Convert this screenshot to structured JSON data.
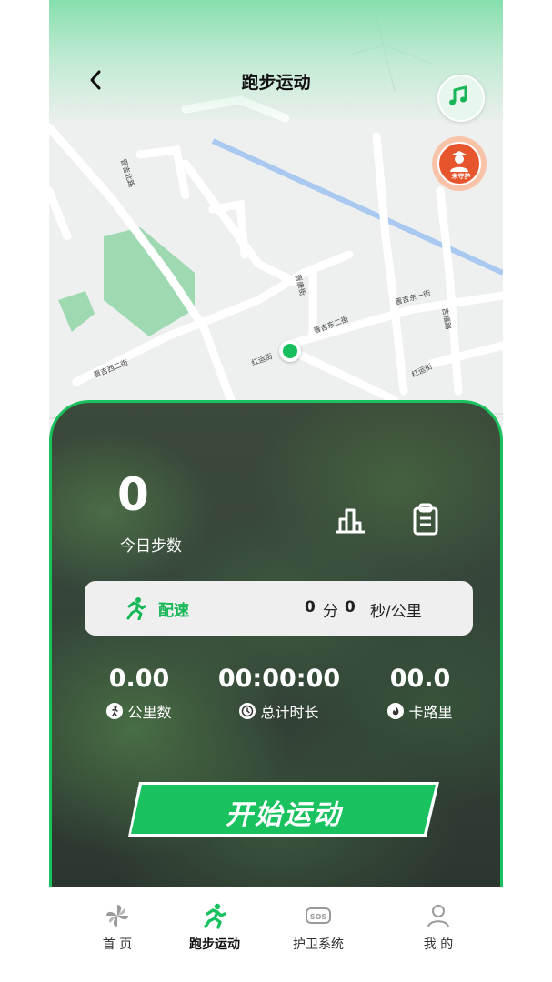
{
  "header": {
    "title": "跑步运动",
    "back_icon": "chevron-left-icon",
    "music_icon": "music-note-icon"
  },
  "map": {
    "guard_badge": "未守护",
    "road_labels": [
      "晋吉北路",
      "晋康街",
      "晋吉东二街",
      "晋吉东一街",
      "吉福路",
      "红运街",
      "红运街",
      "晋吉西二街"
    ]
  },
  "stats": {
    "steps_value": "0",
    "steps_label": "今日步数",
    "chart_icon": "bar-chart-icon",
    "record_icon": "clipboard-icon",
    "pace": {
      "label": "配速",
      "minutes": "0",
      "min_unit": "分",
      "seconds": "0",
      "sec_unit": "秒/公里"
    },
    "distance": {
      "value": "0.00",
      "label": "公里数"
    },
    "duration": {
      "value": "00:00:00",
      "label": "总计时长"
    },
    "calories": {
      "value": "00.0",
      "label": "卡路里"
    }
  },
  "start_button": "开始运动",
  "colors": {
    "accent": "#19c25f",
    "guard": "#e7552d"
  },
  "tabbar": [
    {
      "label": "首 页",
      "icon": "pinwheel-icon",
      "active": false
    },
    {
      "label": "跑步运动",
      "icon": "runner-icon",
      "active": true
    },
    {
      "label": "护卫系统",
      "icon": "sos-icon",
      "active": false
    },
    {
      "label": "我 的",
      "icon": "person-icon",
      "active": false
    }
  ]
}
